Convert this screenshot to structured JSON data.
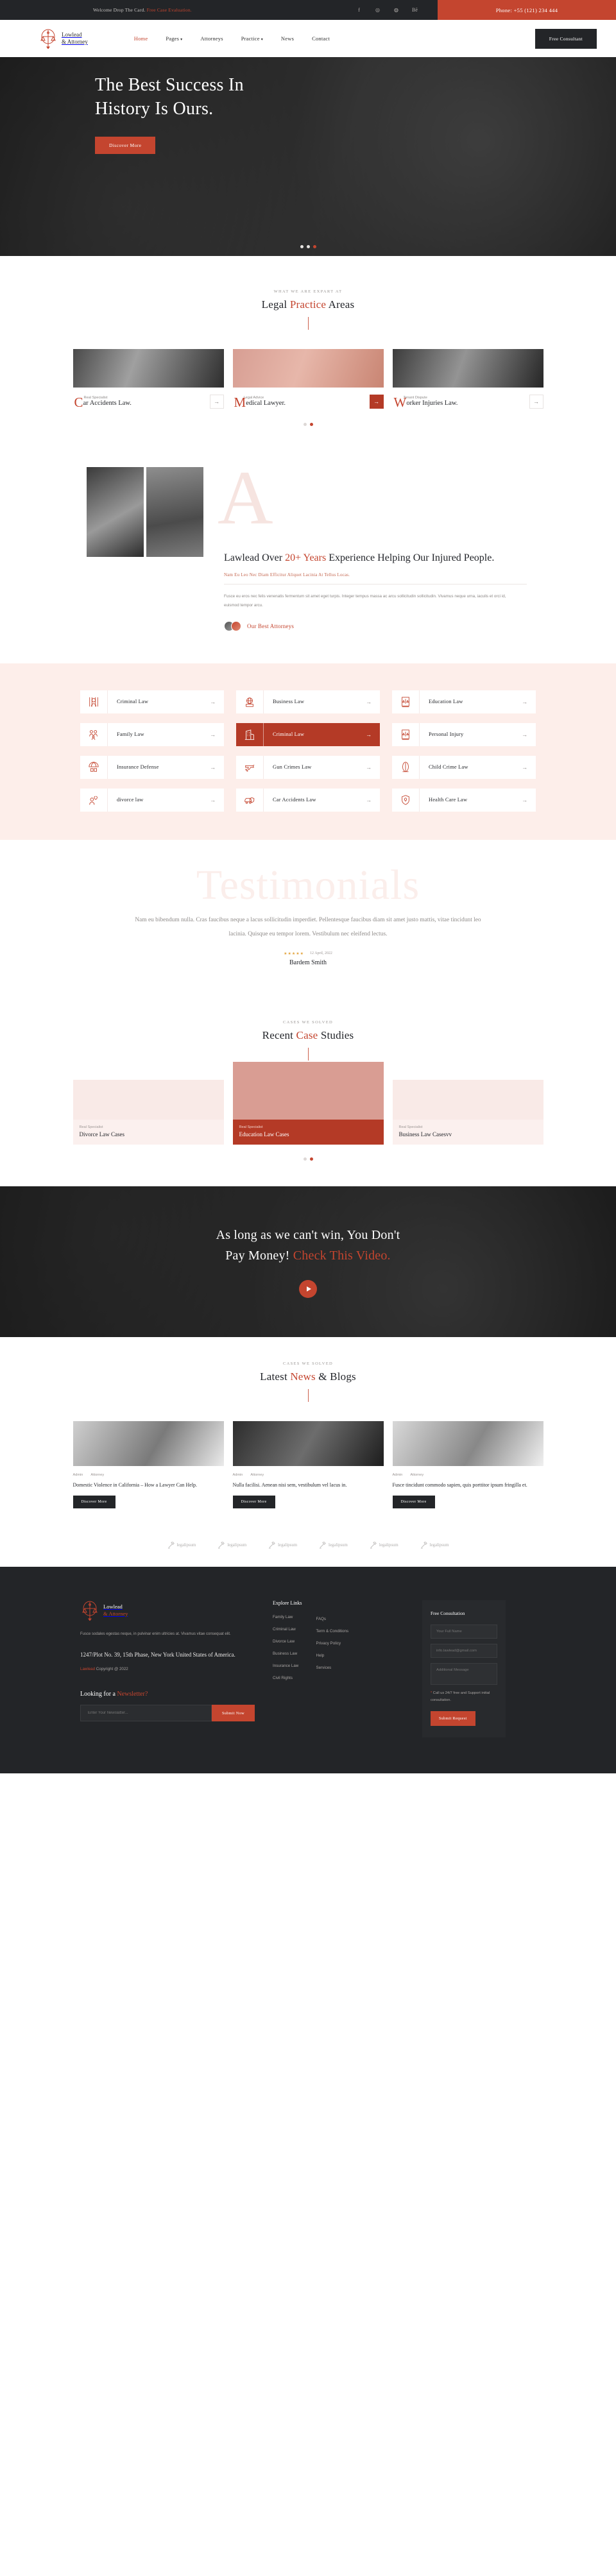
{
  "topbar": {
    "welcome": "Welcome Drop The Card.",
    "welcome_highlight": "Free Case Evaluation.",
    "socials": [
      "f",
      "◎",
      "◍",
      "Bē"
    ],
    "phone": "Phone: +55 (121) 234 444"
  },
  "brand": {
    "name_line1": "Lowlead",
    "name_line2": "& Attorney",
    "logo_icon": "scales-of-justice-icon"
  },
  "nav": {
    "items": [
      {
        "label": "Home",
        "active": true,
        "caret": false
      },
      {
        "label": "Pages",
        "active": false,
        "caret": true
      },
      {
        "label": "Attorneys",
        "active": false,
        "caret": false
      },
      {
        "label": "Practice",
        "active": false,
        "caret": true
      },
      {
        "label": "News",
        "active": false,
        "caret": false
      },
      {
        "label": "Contact",
        "active": false,
        "caret": false
      }
    ],
    "cta": "Free Consultant"
  },
  "hero": {
    "title_line1": "The Best Success In",
    "title_line2": "History Is Ours.",
    "button": "Discover More",
    "slides": 3,
    "active_slide": 3
  },
  "practice": {
    "subtitle": "WHAT WE ARE EXPART AT",
    "title_a": "Legal ",
    "title_hl": "Practice",
    "title_b": " Areas",
    "cards": [
      {
        "kicker": "Real Specialist",
        "cap": "C",
        "rest": "ar Accidents Law.",
        "active": false
      },
      {
        "kicker": "Legal Advice",
        "cap": "M",
        "rest": "edical Lawyer.",
        "active": true
      },
      {
        "kicker": "Tenant Dispute",
        "cap": "W",
        "rest": "orker Injuries Law.",
        "active": false
      }
    ],
    "arrow": "→",
    "dots": 2,
    "active_dot": 2
  },
  "about": {
    "heading_a": "Lawlead Over ",
    "heading_hl": "20+ Years",
    "heading_b": " Experience Helping Our Injured People.",
    "lead": "Nam Eu Leo Nec Diam Efficitur Aliquet Lacinia At Tellus Locas.",
    "paragraph": "Fusce eu eros nec felis venenatis fermentum sit amet eget turpis. Integer tempus massa ac arcu sollicitudin sollicitudin. Vivamus neque urna, iaculis et orci id, euismod tempor arcu.",
    "cta_label": "Our Best Attorneys",
    "watermark": "A"
  },
  "services": {
    "items": [
      {
        "label": "Criminal Law",
        "icon": "prison-bars-icon",
        "active": false
      },
      {
        "label": "Business Law",
        "icon": "globe-book-icon",
        "active": false
      },
      {
        "label": "Education Law",
        "icon": "law-book-icon",
        "active": false
      },
      {
        "label": "Family Law",
        "icon": "family-icon",
        "active": false
      },
      {
        "label": "Criminal Law",
        "icon": "building-icon",
        "active": true
      },
      {
        "label": "Personal Injury",
        "icon": "scales-book-icon",
        "active": false
      },
      {
        "label": "Insurance Defense",
        "icon": "umbrella-icon",
        "active": false
      },
      {
        "label": "Gun Crimes Law",
        "icon": "gun-icon",
        "active": false
      },
      {
        "label": "Child Crime Law",
        "icon": "child-icon",
        "active": false
      },
      {
        "label": "divorce law",
        "icon": "broken-heart-icon",
        "active": false
      },
      {
        "label": "Car Accidents Law",
        "icon": "car-shield-icon",
        "active": false
      },
      {
        "label": "Health Care Law",
        "icon": "health-shield-icon",
        "active": false
      }
    ],
    "arrow": "→"
  },
  "testimonials": {
    "watermark": "Testimonials",
    "quote": "Nam eu bibendum nulla. Cras faucibus neque a lacus sollicitudin imperdiet. Pellentesque faucibus diam sit amet justo mattis, vitae tincidunt leo lacinia. Quisque eu tempor lorem. Vestibulum nec eleifend lectus.",
    "stars": "★★★★★",
    "date": "12 April, 2022",
    "author": "Bardem Smith"
  },
  "cases": {
    "subtitle": "CASES WE SOLVED",
    "title_a": "Recent ",
    "title_hl": "Case",
    "title_b": " Studies",
    "items": [
      {
        "kicker": "Real Specialist",
        "name": "Divorce Law Cases",
        "active": false
      },
      {
        "kicker": "Real Specialist",
        "name": "Education Law Cases",
        "active": true
      },
      {
        "kicker": "Real Specialist",
        "name": "Business Law Casesvv",
        "active": false
      }
    ],
    "dots": 2,
    "active_dot": 2
  },
  "videocta": {
    "line1": "As long as we can't win, You Don't",
    "line2_a": "Pay Money! ",
    "line2_hl": "Check This Video.",
    "play_icon": "play-icon"
  },
  "blog": {
    "subtitle": "CASES WE SOLVED",
    "title_a": "Latest ",
    "title_hl": "News",
    "title_b": " & Blogs",
    "posts": [
      {
        "author": "Admin",
        "category": "Attorney",
        "title": "Domestic Violence in California – How a Lawyer Can Help.",
        "button": "Discover More"
      },
      {
        "author": "Admin",
        "category": "Attorney",
        "title": "Nulla facilisi. Aenean nisi sem, vestibulum vel lacus in.",
        "button": "Discover More"
      },
      {
        "author": "Admin",
        "category": "Attorney",
        "title": "Fusce tincidunt commodo sapien, quis porttitor ipsum fringilla et.",
        "button": "Discover More"
      }
    ]
  },
  "brands": [
    {
      "name": "legalipsum",
      "icon": "gavel-icon"
    },
    {
      "name": "legalipsum",
      "icon": "gavel-icon"
    },
    {
      "name": "legalipsum",
      "icon": "gavel-icon"
    },
    {
      "name": "legalipsum",
      "icon": "gavel-icon"
    },
    {
      "name": "legalipsum",
      "icon": "gavel-icon"
    },
    {
      "name": "legalipsum",
      "icon": "gavel-icon"
    }
  ],
  "footer": {
    "desc": "Fusce sodales egestas neque, in pulvinar enim ultricies at. Vivamus vitae consequat elit.",
    "address": "1247/Plot No. 39, 15th Phase, New York United States of America.",
    "copyright_brand": "Lawlead",
    "copyright_rest": " Copyright @ 2022",
    "newsletter_a": "Looking for a ",
    "newsletter_hl": "Newsletter?",
    "newsletter_placeholder": "Enter Your Newslatter...",
    "newsletter_button": "Submit Now",
    "links_head": "Explore Links",
    "links_col1": [
      "Family Law",
      "Criminal Law",
      "Divorce Law",
      "Business Law",
      "Insurance Law",
      "Civil Rights"
    ],
    "links_col2": [
      "FAQs",
      "Term & Conditions",
      "Privacy Policy",
      "Help",
      "Services"
    ],
    "form_head": "Free Consultation",
    "form_name_placeholder": "Your Full Name",
    "form_email_placeholder": "info.lawlead@gmail.com",
    "form_message_placeholder": "Additional Message",
    "form_note_ast": "*",
    "form_note": " Call us 24/7 free and Support initial consultation.",
    "form_button": "Submit Request"
  }
}
